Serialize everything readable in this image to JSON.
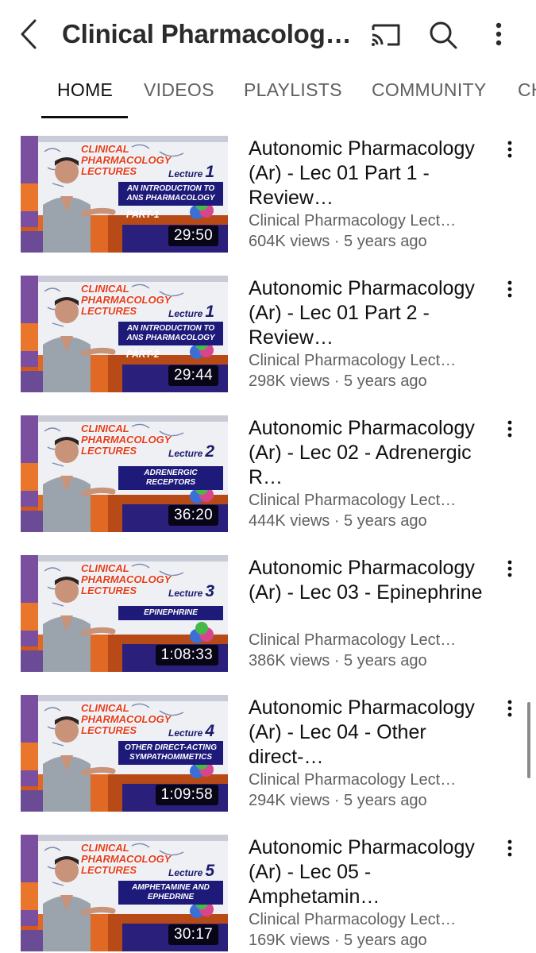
{
  "header": {
    "title": "Clinical Pharmacology...",
    "back_icon": "chevron-left-icon",
    "cast_icon": "cast-icon",
    "search_icon": "search-icon",
    "more_icon": "more-vertical-icon"
  },
  "tabs": [
    {
      "label": "HOME",
      "active": true
    },
    {
      "label": "VIDEOS",
      "active": false
    },
    {
      "label": "PLAYLISTS",
      "active": false
    },
    {
      "label": "COMMUNITY",
      "active": false
    },
    {
      "label": "CH",
      "active": false
    }
  ],
  "videos": [
    {
      "title": "Autonomic Pharmacology (Ar) - Lec 01 Part 1 - Review…",
      "channel": "Clinical Pharmacology Lect…",
      "meta": "604K views · 5 years ago",
      "duration": "29:50",
      "thumb": {
        "lecture_label": "Lecture",
        "lecture_num": "1",
        "topic": "AN INTRODUCTION TO ANS PHARMACOLOGY",
        "part": "PART-1"
      }
    },
    {
      "title": "Autonomic Pharmacology (Ar) - Lec 01 Part 2 -Review…",
      "channel": "Clinical Pharmacology Lect…",
      "meta": "298K views · 5 years ago",
      "duration": "29:44",
      "thumb": {
        "lecture_label": "Lecture",
        "lecture_num": "1",
        "topic": "AN INTRODUCTION TO ANS PHARMACOLOGY",
        "part": "PART-2"
      }
    },
    {
      "title": "Autonomic Pharmacology (Ar) - Lec 02 - Adrenergic R…",
      "channel": "Clinical Pharmacology Lect…",
      "meta": "444K views · 5 years ago",
      "duration": "36:20",
      "thumb": {
        "lecture_label": "Lecture",
        "lecture_num": "2",
        "topic": "ADRENERGIC RECEPTORS",
        "part": ""
      }
    },
    {
      "title": "Autonomic Pharmacology (Ar) - Lec 03 - Epinephrine",
      "channel": "Clinical Pharmacology Lect…",
      "meta": "386K views · 5 years ago",
      "duration": "1:08:33",
      "thumb": {
        "lecture_label": "Lecture",
        "lecture_num": "3",
        "topic": "EPINEPHRINE",
        "part": ""
      }
    },
    {
      "title": "Autonomic Pharmacology (Ar) - Lec 04 - Other direct-…",
      "channel": "Clinical Pharmacology Lect…",
      "meta": "294K views · 5 years ago",
      "duration": "1:09:58",
      "thumb": {
        "lecture_label": "Lecture",
        "lecture_num": "4",
        "topic": "OTHER DIRECT-ACTING SYMPATHOMIMETICS",
        "part": ""
      }
    },
    {
      "title": "Autonomic Pharmacology (Ar) - Lec 05 - Amphetamin…",
      "channel": "Clinical Pharmacology Lect…",
      "meta": "169K views · 5 years ago",
      "duration": "30:17",
      "thumb": {
        "lecture_label": "Lecture",
        "lecture_num": "5",
        "topic": "AMPHETAMINE AND EPHEDRINE",
        "part": ""
      }
    }
  ],
  "thumb_brand": "CLINICAL PHARMACOLOGY LECTURES",
  "colors": {
    "text_primary": "#0f0f0f",
    "text_secondary": "#606060",
    "thumb_banner": "#1d1a7a",
    "brand_red": "#e43b1a"
  }
}
